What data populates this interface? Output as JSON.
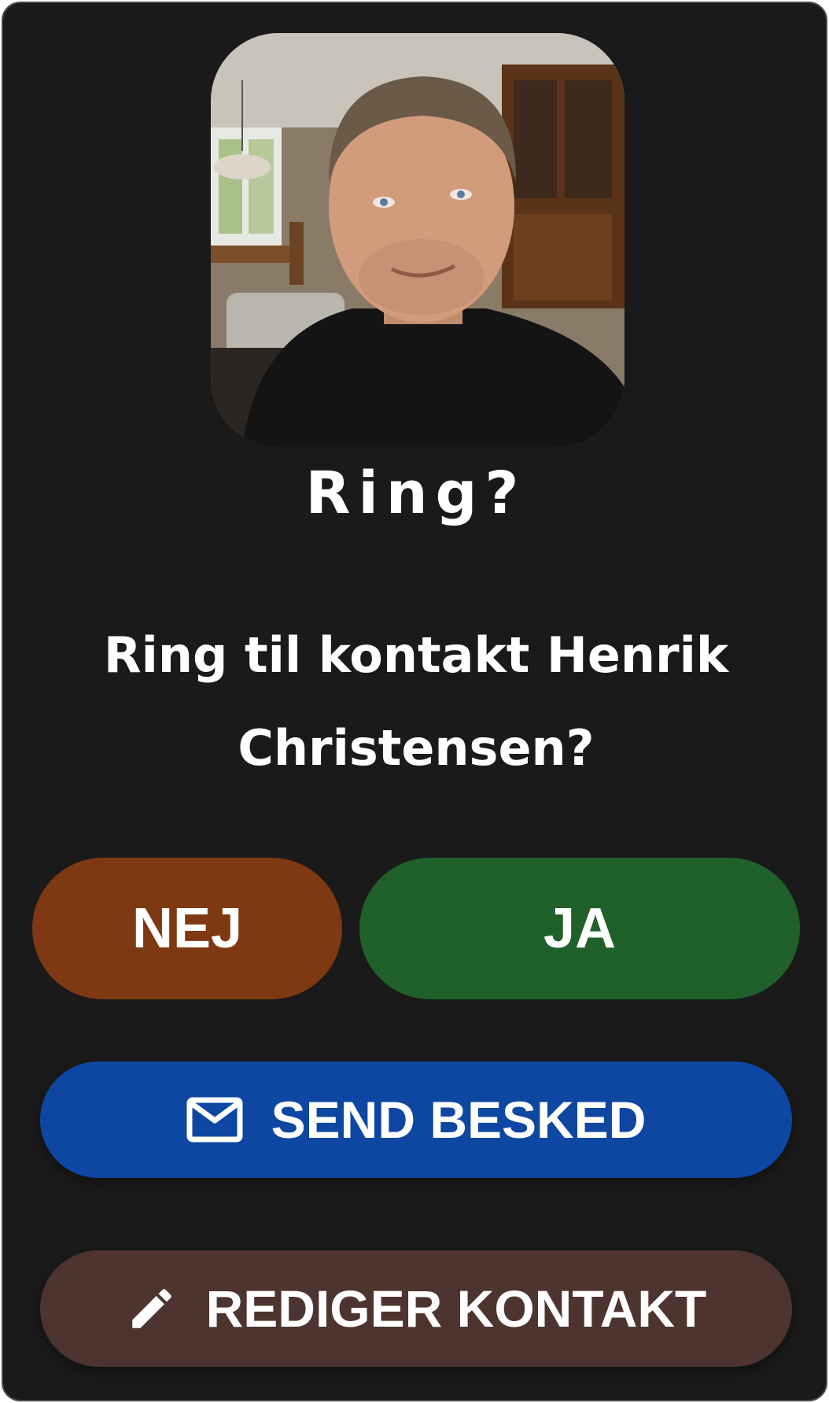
{
  "dialog": {
    "title": "Ring?",
    "message": "Ring til kontakt Henrik Christensen?",
    "avatar_icon": "contact-photo"
  },
  "buttons": {
    "no_label": "NEJ",
    "yes_label": "JA",
    "send_message_label": "SEND BESKED",
    "send_message_icon": "envelope-icon",
    "edit_contact_label": "REDIGER KONTAKT",
    "edit_contact_icon": "pencil-icon"
  },
  "colors": {
    "background": "#1a1a1a",
    "no_button": "#7e3812",
    "yes_button": "#20602a",
    "send_button": "#0d47a1",
    "edit_button": "#4e342e",
    "text": "#ffffff"
  }
}
